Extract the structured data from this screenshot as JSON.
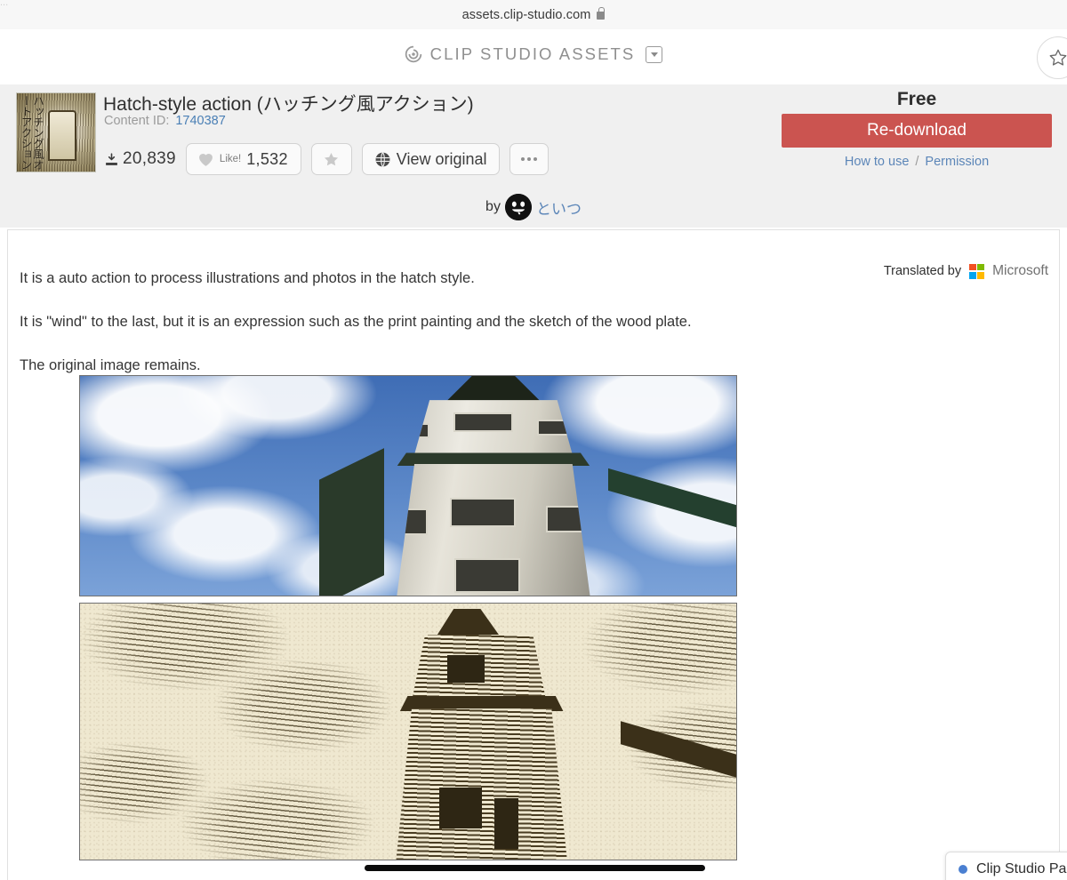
{
  "browser": {
    "url": "assets.clip-studio.com",
    "lock_icon": "lock-icon",
    "corner_artifact": "..."
  },
  "site_header": {
    "brand": "CLIP STUDIO ASSETS",
    "brand_mark_icon": "clip-studio-spiral-icon",
    "brand_dropdown_icon": "chevron-down-boxed-icon",
    "favorite_icon": "star-outline-icon"
  },
  "asset": {
    "title": "Hatch-style action (ハッチング風アクション)",
    "content_id_label": "Content ID:",
    "content_id": "1740387",
    "thumbnail_text": "ハッチング風オートアクション",
    "download_icon": "download-icon",
    "download_count": "20,839",
    "like": {
      "icon": "heart-icon",
      "label": "Like!",
      "count": "1,532"
    },
    "favorite_button_icon": "star-filled-icon",
    "view_original": {
      "icon": "globe-icon",
      "label": "View original"
    },
    "more_button_icon": "ellipsis-icon",
    "price": "Free",
    "download_button": "Re-download",
    "how_to_use": "How to use",
    "links_separator": "/",
    "permission": "Permission",
    "accent_color": "#cb5450",
    "link_color": "#5c86b8"
  },
  "author": {
    "by_label": "by",
    "avatar_icon": "smiley-avatar-icon",
    "name": "といつ"
  },
  "description": {
    "paragraphs": [
      "It is a auto action to process illustrations and photos in the hatch style.",
      "It is \"wind\" to the last, but it is an expression such as the print painting and the sketch of the wood plate.",
      "The original image remains."
    ],
    "line1": "It is a auto action to process illustrations and photos in the hatch style.",
    "line2": "It is \"wind\" to the last, but it is an expression such as the print painting and the sketch of the wood plate.",
    "line3": "The original image remains."
  },
  "translation": {
    "label": "Translated by",
    "provider": "Microsoft",
    "logo_icon": "microsoft-logo-icon",
    "logo_colors": [
      "#f25022",
      "#7fba00",
      "#00a4ef",
      "#ffb900"
    ]
  },
  "media": [
    {
      "name": "photo-original",
      "caption": "Original photo of an octagonal tower against a blue cloudy sky"
    },
    {
      "name": "photo-hatched",
      "caption": "Hatch-style processed version of the tower photo in sepia"
    }
  ],
  "toast": {
    "dot_color": "#4a7fd1",
    "text": "Clip Studio Pa"
  },
  "scrollbar": {
    "orientation": "horizontal",
    "color": "#0b0b0b"
  }
}
